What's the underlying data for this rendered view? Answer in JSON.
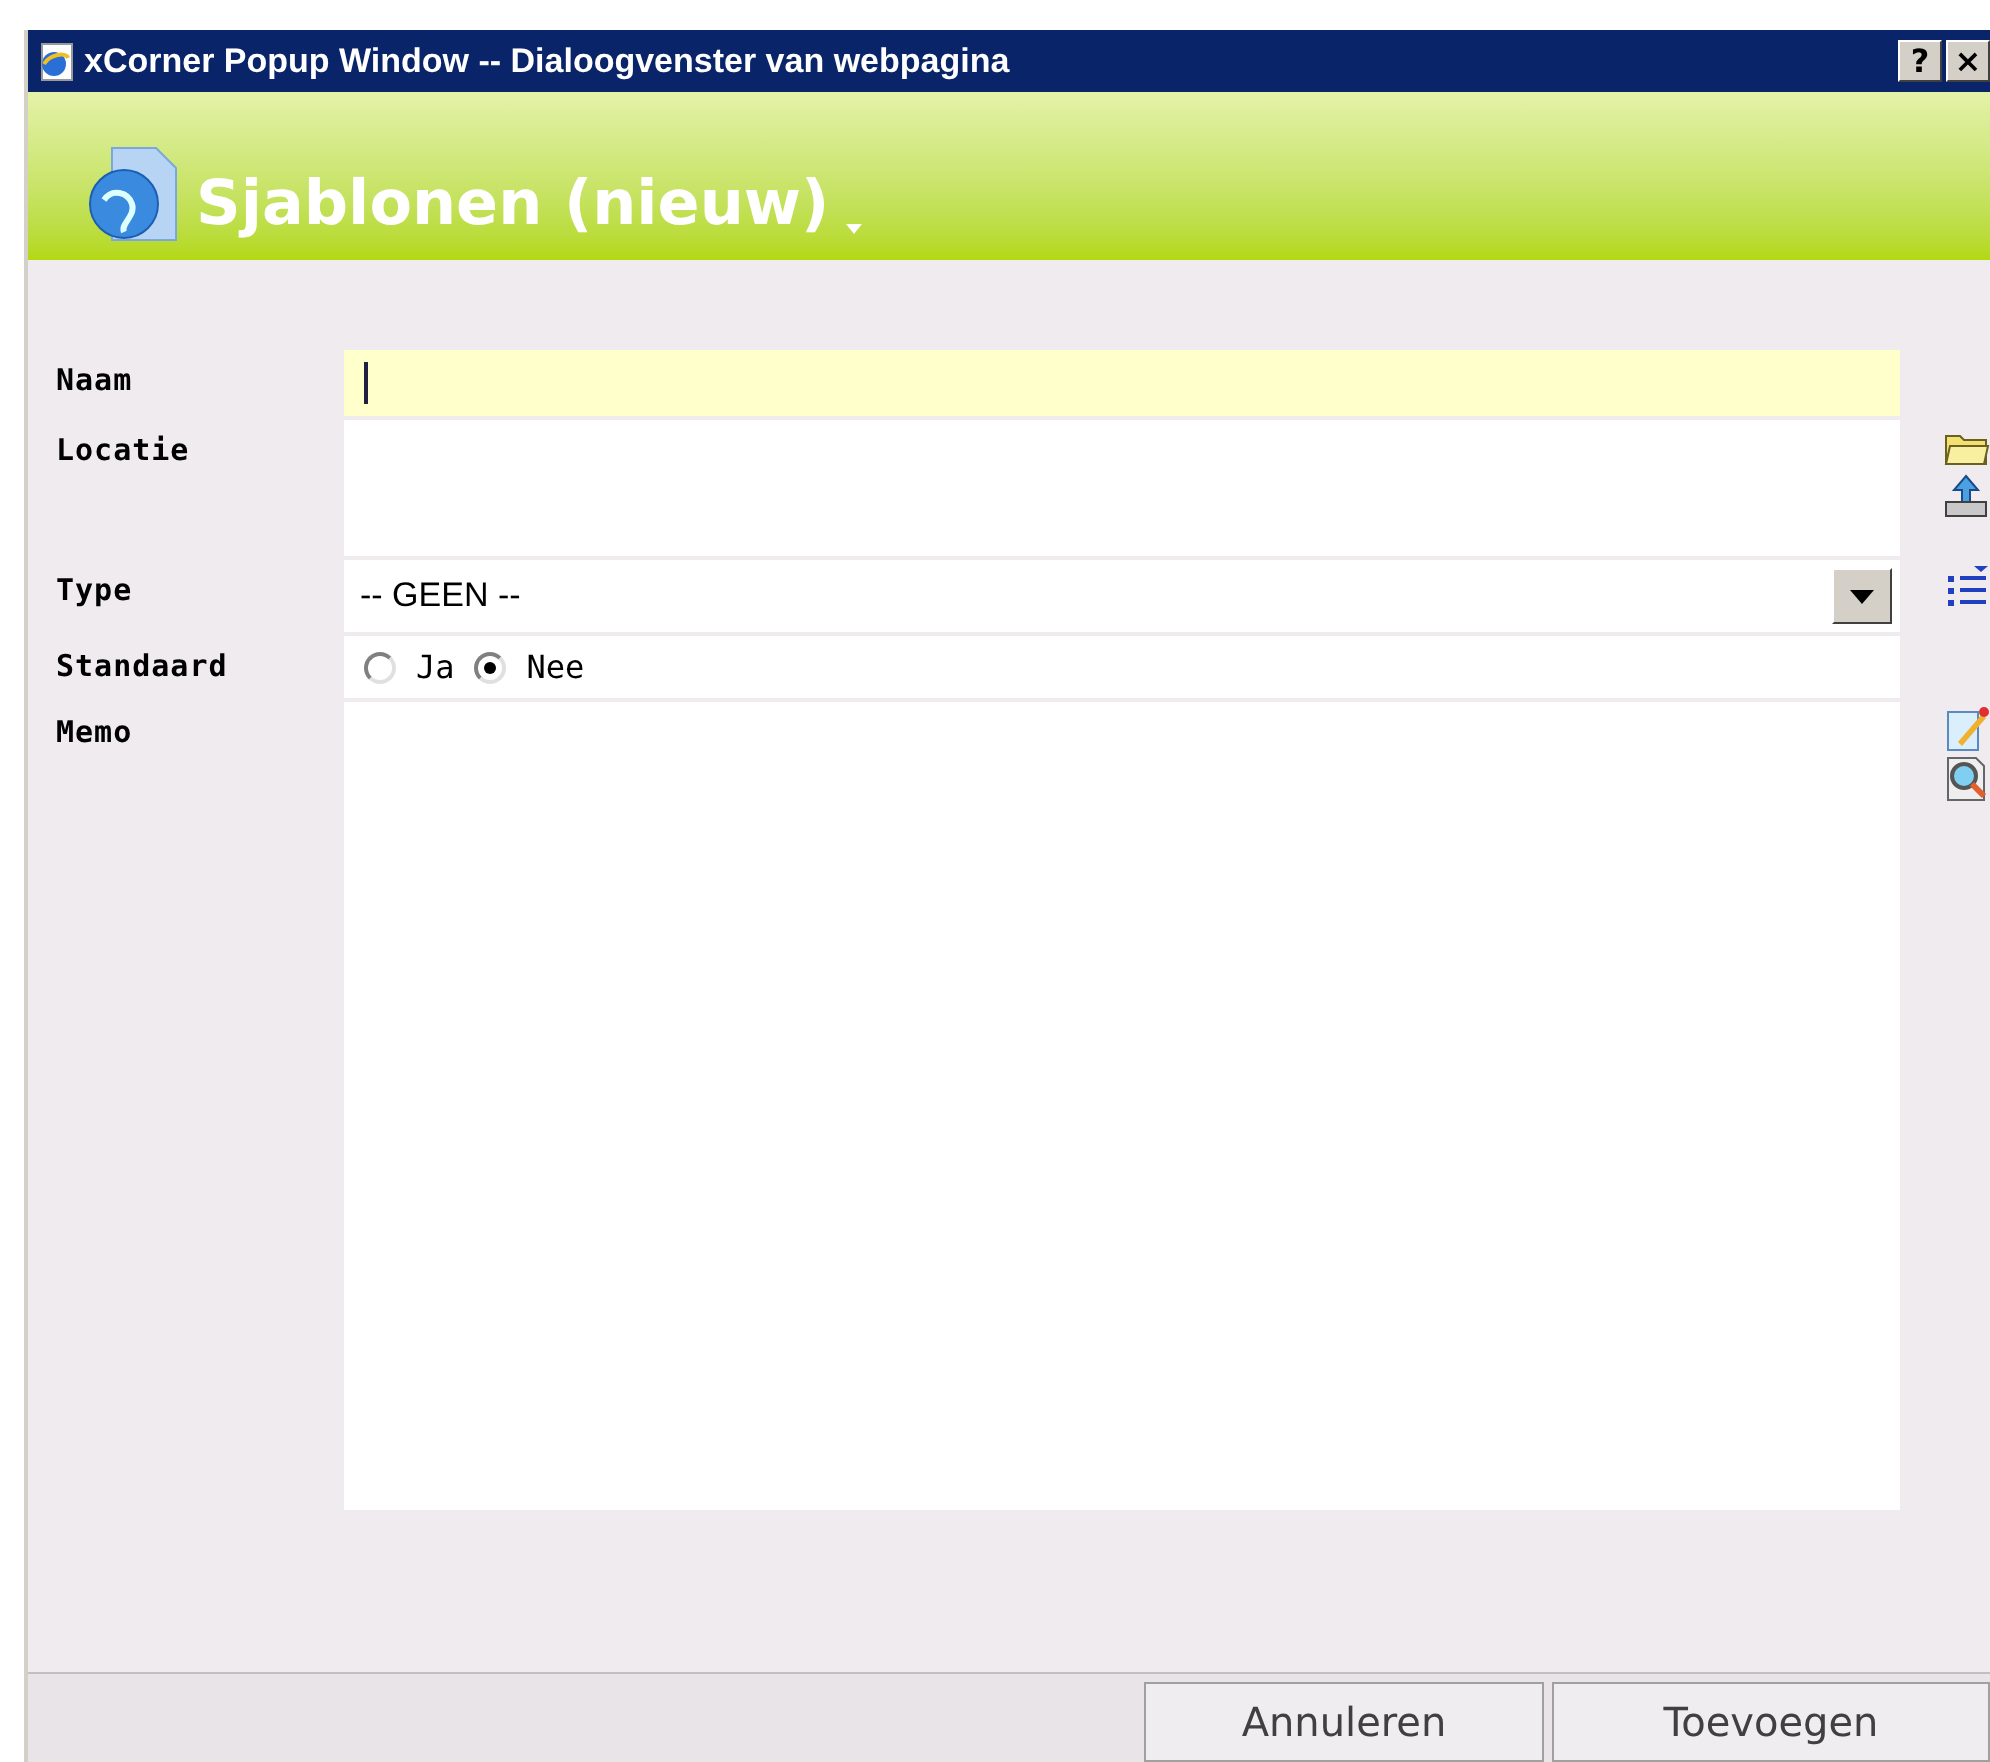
{
  "window": {
    "title": "xCorner Popup Window -- Dialoogvenster van webpagina",
    "buttons": [
      "?",
      "×"
    ]
  },
  "header": {
    "title": "Sjablonen (nieuw)",
    "has_menu": true
  },
  "fields": [
    {
      "kind": "text",
      "label": "Naam",
      "focused": true
    },
    {
      "kind": "location",
      "label": "Locatie",
      "focused": false
    },
    {
      "kind": "select",
      "label": "Type",
      "value": "-- GEEN --"
    },
    {
      "kind": "radio",
      "label": "Standaard",
      "options": [
        {
          "label": "Ja",
          "selected": false
        },
        {
          "label": "Nee",
          "selected": true
        }
      ]
    },
    {
      "kind": "memo",
      "label": "Memo",
      "focused": false
    }
  ],
  "buttons": [
    "Annuleren",
    "Toevoegen"
  ]
}
